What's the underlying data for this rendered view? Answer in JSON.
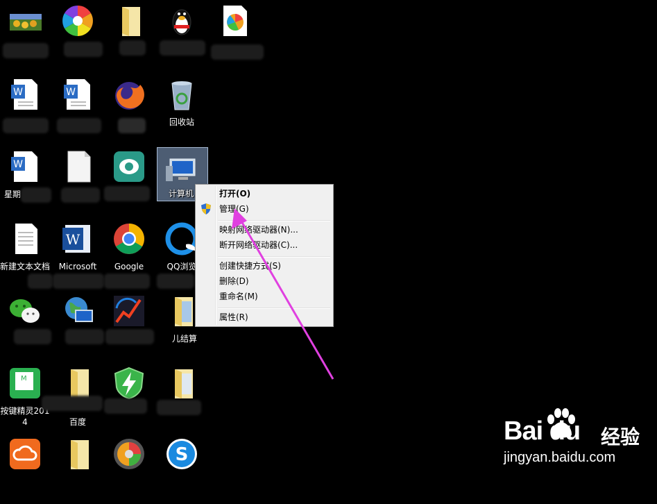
{
  "desktop": {
    "icons": {
      "computer": "计算机",
      "recycle_bin": "回收站",
      "new_text_doc": "新建文本文档",
      "word": "Microsoft",
      "chrome": "Google",
      "qq_browser": "QQ浏览",
      "keyjingling": "按键精灵2014",
      "baidu_folder": "百度",
      "jiesuan": "儿结算",
      "xingqi": "星期"
    }
  },
  "context_menu": {
    "items": [
      {
        "label": "打开(O)"
      },
      {
        "label": "管理(G)"
      },
      {
        "label": "映射网络驱动器(N)..."
      },
      {
        "label": "断开网络驱动器(C)..."
      },
      {
        "label": "创建快捷方式(S)"
      },
      {
        "label": "删除(D)"
      },
      {
        "label": "重命名(M)"
      },
      {
        "label": "属性(R)"
      }
    ]
  },
  "watermark": {
    "logo": "Bai du",
    "brand": "经验",
    "url": "jingyan.baidu.com"
  },
  "colors": {
    "arrow": "#e040e0",
    "selection": "#8caad2",
    "menu_bg": "#f0f0f0"
  }
}
